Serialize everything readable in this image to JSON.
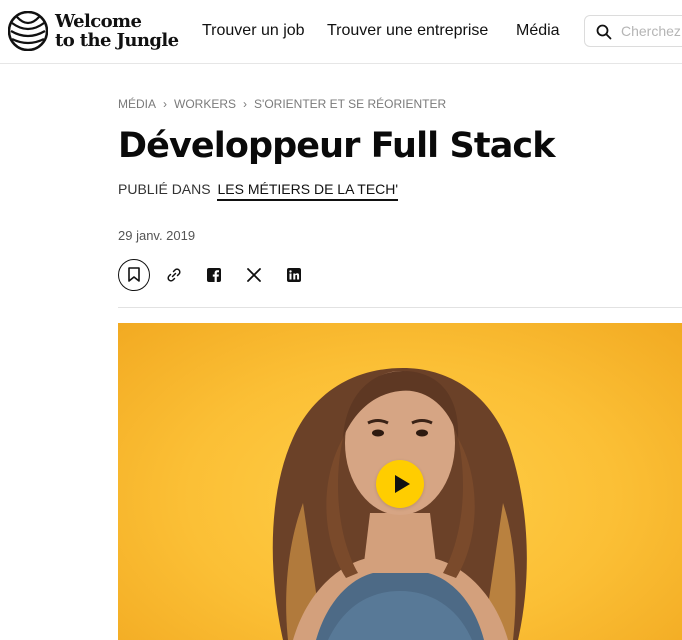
{
  "header": {
    "brand_line1": "Welcome",
    "brand_line2": "to the Jungle",
    "nav": [
      "Trouver un job",
      "Trouver une entreprise",
      "Média"
    ],
    "search_placeholder": "Cherchez"
  },
  "breadcrumb": [
    "MÉDIA",
    "WORKERS",
    "S'ORIENTER ET SE RÉORIENTER"
  ],
  "article": {
    "title": "Développeur Full Stack",
    "published_prefix": "PUBLIÉ DANS",
    "category": "LES MÉTIERS DE LA TECH'",
    "date": "29 janv. 2019"
  },
  "share_icons": [
    "bookmark-icon",
    "link-icon",
    "facebook-icon",
    "x-icon",
    "linkedin-icon"
  ],
  "hero": {
    "background_color": "#fbbf35",
    "play_button_color": "#ffcd00"
  }
}
